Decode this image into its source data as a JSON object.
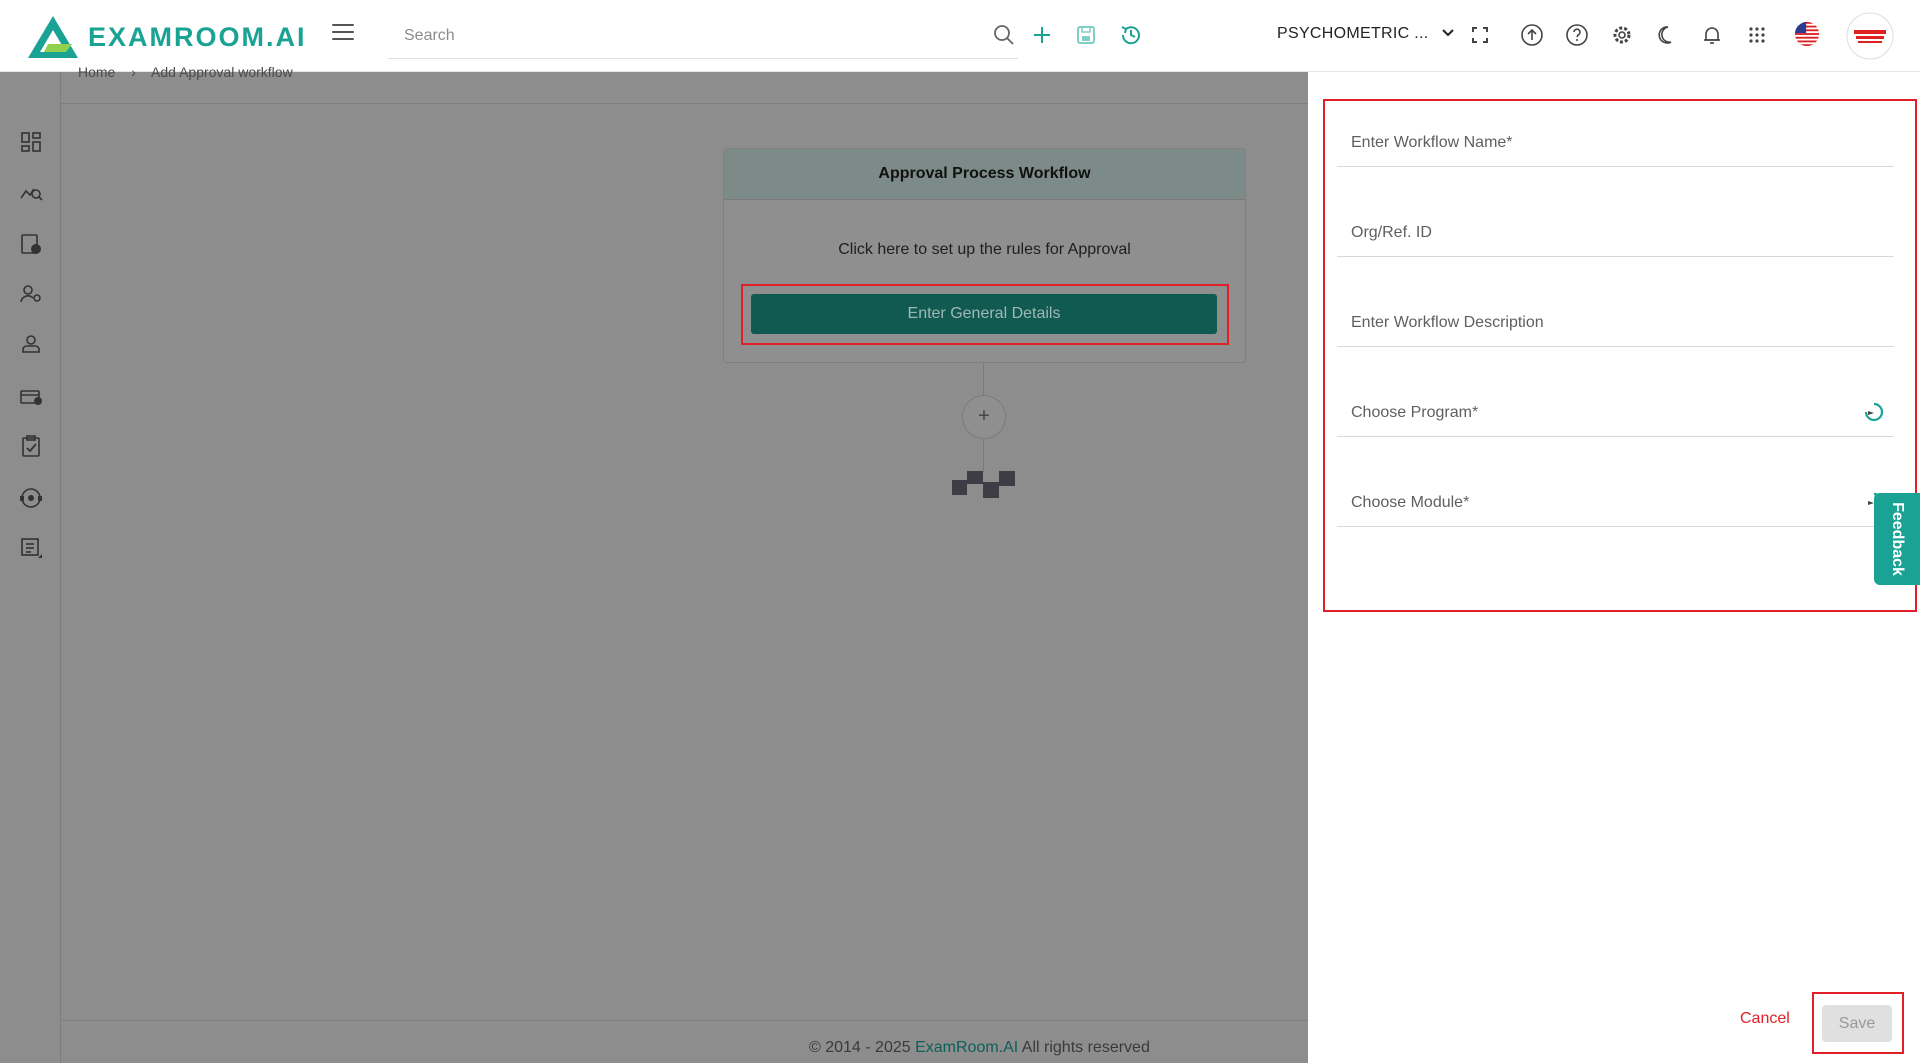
{
  "header": {
    "brand": "EXAMROOM.AI",
    "search_placeholder": "Search",
    "org_selector": "PSYCHOMETRIC ..."
  },
  "breadcrumb": {
    "home": "Home",
    "separator": "›",
    "current": "Add Approval workflow"
  },
  "workflow_card": {
    "title": "Approval Process Workflow",
    "subtitle": "Click here to set up the rules for Approval",
    "button_label": "Enter General Details",
    "add_node_label": "+"
  },
  "drawer": {
    "fields": [
      {
        "placeholder": "Enter Workflow Name*"
      },
      {
        "placeholder": "Org/Ref. ID"
      },
      {
        "placeholder": "Enter Workflow Description"
      },
      {
        "placeholder": "Choose Program*"
      },
      {
        "placeholder": "Choose Module*"
      }
    ],
    "cancel_label": "Cancel",
    "save_label": "Save"
  },
  "feedback_tab": "Feedback",
  "footer": {
    "prefix": "© 2014 - 2025",
    "brand": "ExamRoom.AI",
    "suffix": "All rights reserved"
  },
  "colors": {
    "brand": "#1aa394",
    "accent_dark": "#115a52",
    "highlight": "#e11f26",
    "overlay": "#8d8d8d"
  },
  "icons": [
    "logo-icon",
    "menu-icon",
    "search-icon",
    "add-icon",
    "save-icon",
    "history-icon",
    "chevron-down-icon",
    "fullscreen-icon",
    "upload-icon",
    "help-icon",
    "settings-icon",
    "dark-mode-icon",
    "notification-icon",
    "apps-grid-icon",
    "us-flag-icon",
    "avatar"
  ]
}
